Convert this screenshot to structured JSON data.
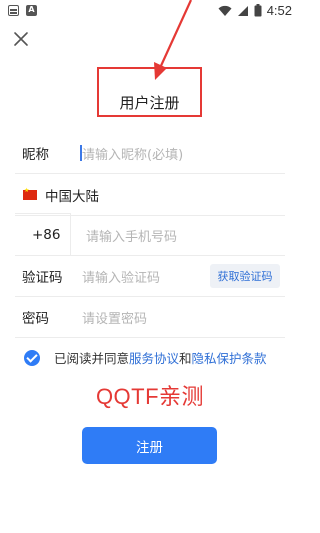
{
  "status_bar": {
    "time": "4:52"
  },
  "title": "用户注册",
  "form": {
    "nickname": {
      "label": "昵称",
      "placeholder": "请输入昵称(必填)"
    },
    "region": {
      "label": "中国大陆"
    },
    "phone": {
      "code": "+86",
      "placeholder": "请输入手机号码"
    },
    "verify": {
      "label": "验证码",
      "placeholder": "请输入验证码",
      "button": "获取验证码"
    },
    "password": {
      "label": "密码",
      "placeholder": "请设置密码"
    }
  },
  "agreement": {
    "prefix": "已阅读并同意",
    "service": "服务协议",
    "and": "和",
    "privacy": "隐私保护条款",
    "checked": true
  },
  "watermark": "QQTF亲测",
  "submit": "注册",
  "colors": {
    "accent": "#2f7cf6",
    "link": "#2f6fd6",
    "annotation": "#e53935"
  }
}
